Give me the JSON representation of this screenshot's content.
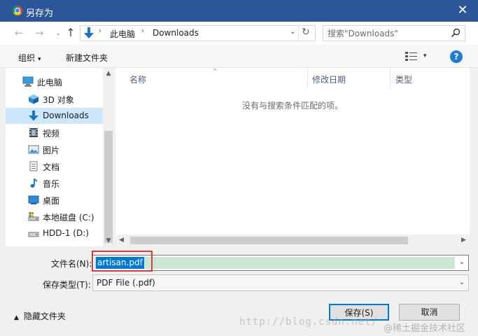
{
  "window": {
    "title": "另存为",
    "close_glyph": "✕"
  },
  "navigation": {
    "back_glyph": "←",
    "forward_glyph": "→",
    "recent_glyph": "⌄",
    "up_glyph": "↑",
    "breadcrumbs": [
      "此电脑",
      "Downloads"
    ],
    "separator": "›",
    "dropdown_glyph": "⌄",
    "refresh_glyph": "↻"
  },
  "search": {
    "placeholder": "搜索\"Downloads\""
  },
  "toolbar": {
    "organize_label": "组织",
    "organize_caret": "▾",
    "new_folder_label": "新建文件夹",
    "view_caret": "▾",
    "help_glyph": "?"
  },
  "sidebar": {
    "items": [
      {
        "label": "此电脑",
        "icon": "computer-icon"
      },
      {
        "label": "3D 对象",
        "icon": "cube-icon"
      },
      {
        "label": "Downloads",
        "icon": "download-icon",
        "selected": true
      },
      {
        "label": "视频",
        "icon": "video-icon"
      },
      {
        "label": "图片",
        "icon": "picture-icon"
      },
      {
        "label": "文档",
        "icon": "document-icon"
      },
      {
        "label": "音乐",
        "icon": "music-icon"
      },
      {
        "label": "桌面",
        "icon": "desktop-icon"
      },
      {
        "label": "本地磁盘 (C:)",
        "icon": "drive-c-icon"
      },
      {
        "label": "HDD-1 (D:)",
        "icon": "drive-icon"
      }
    ]
  },
  "scroll": {
    "up": "▲",
    "down": "▼",
    "left": "◀",
    "right": "▶"
  },
  "filelist": {
    "columns": [
      "名称",
      "修改日期",
      "类型"
    ],
    "sort_glyph": "^",
    "empty_message": "没有与搜索条件匹配的项。"
  },
  "form": {
    "filename_label": "文件名(N):",
    "filename_value": "artisan.pdf",
    "filetype_label": "保存类型(T):",
    "filetype_value": "PDF File (.pdf)",
    "dropdown_glyph": "⌄"
  },
  "footer": {
    "hide_folders_label": "隐藏文件夹",
    "hide_caret": "▲",
    "save_label": "保存(S)",
    "cancel_label": "取消"
  },
  "watermark": {
    "url_text": "http://blog.csdn.net/",
    "site_text": "@稀土掘金技术社区"
  },
  "colors": {
    "titlebar": "#2b579a",
    "selection": "#cce8ff",
    "text_selection": "#0078d7",
    "highlight_box": "#e53935",
    "help": "#1f7ad8"
  }
}
